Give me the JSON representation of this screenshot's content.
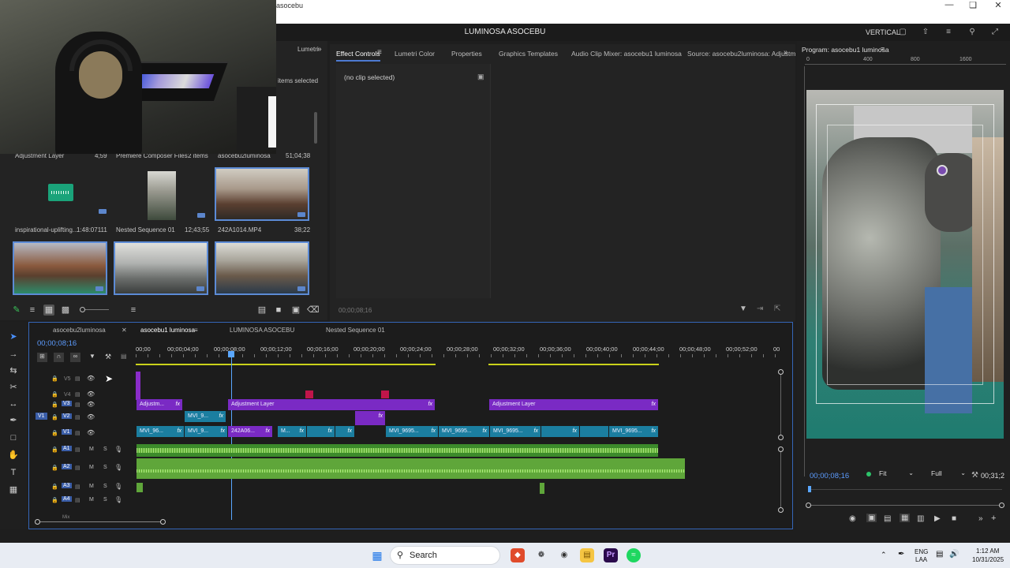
{
  "app": {
    "small_title": "asocebu",
    "project_title": "LUMINOSA ASOCEBU",
    "layout_label": "VERTICAL"
  },
  "project_panel": {
    "tab_label": "Lumetri",
    "items_selected": "items selected",
    "row0": [
      {
        "label": "Adjustment Layer",
        "meta": "4;59"
      },
      {
        "label": "Premiere Composer Files",
        "meta": "2 items"
      },
      {
        "label": "asocebu2luminosa",
        "meta": "51;04;38"
      }
    ],
    "row1": [
      {
        "label": "inspirational-uplifting...",
        "meta": "1:48:07111"
      },
      {
        "label": "Nested Sequence 01",
        "meta": "12;43;55"
      },
      {
        "label": "242A1014.MP4",
        "meta": "38;22"
      }
    ]
  },
  "effect_tabs": [
    "Effect Controls",
    "Lumetri Color",
    "Properties",
    "Graphics Templates",
    "Audio Clip Mixer: asocebu1 luminosa",
    "Source: asocebu2luminosa: Adjustm"
  ],
  "effect_controls": {
    "no_clip": "(no clip selected)",
    "timecode": "00;00;08;16"
  },
  "program": {
    "title": "Program: asocebu1 luminosa",
    "ruler": [
      "0",
      "400",
      "800",
      "1600"
    ],
    "timecode": "00;00;08;16",
    "fit": "Fit",
    "quality": "Full",
    "duration": "00;31;2"
  },
  "timeline": {
    "tabs": [
      "asocebu2luminosa",
      "asocebu1 luminosa",
      "LUMINOSA ASOCEBU",
      "Nested Sequence 01"
    ],
    "timecode": "00;00;08;16",
    "ruler": [
      "00;00",
      "00;00;04;00",
      "00;00;08;00",
      "00;00;12;00",
      "00;00;16;00",
      "00;00;20;00",
      "00;00;24;00",
      "00;00;28;00",
      "00;00;32;00",
      "00;00;36;00",
      "00;00;40;00",
      "00;00;44;00",
      "00;00;48;00",
      "00;00;52;00",
      "00"
    ],
    "tracks": [
      "V5",
      "V4",
      "V3",
      "V2",
      "V1",
      "A1",
      "A2",
      "A3",
      "A4"
    ],
    "source_patch_v": "V1",
    "mix_label": "Mix",
    "clips_v3": [
      "Adjustm...",
      "Adjustment Layer",
      "Adjustment Layer"
    ],
    "clips_v2": [
      "MVI_9..."
    ],
    "clips_v1": [
      "MVI_96...",
      "MVI_9...",
      "242A06...",
      "M...",
      "MVI_9695...",
      "MVI_9695...",
      "MVI_9695...",
      "MVI_9695..."
    ],
    "fx": "fx",
    "mute": "M",
    "solo": "S"
  },
  "taskbar": {
    "search": "Search",
    "lang1": "ENG",
    "lang2": "LAA",
    "time": "1:12 AM",
    "date": "10/31/2025"
  },
  "colors": {
    "accent_blue": "#4d7ad1",
    "adjustment_purple": "#7a2ac4",
    "video_clip_teal": "#1b7ea0",
    "audio_green": "#3c8a2b",
    "playhead_blue": "#5aa7ff"
  }
}
